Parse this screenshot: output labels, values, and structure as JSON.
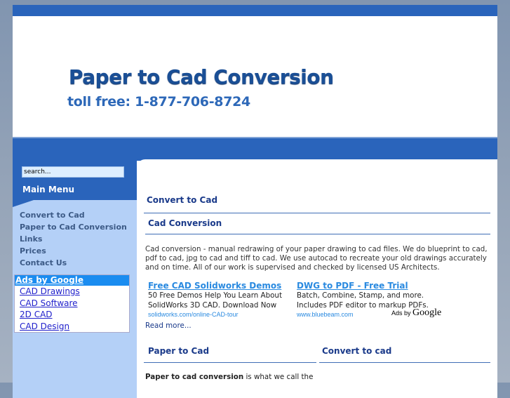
{
  "header": {
    "title": "Paper to Cad Conversion",
    "phone": "toll free: 1-877-706-8724"
  },
  "sidebar": {
    "search_placeholder": "search...",
    "main_menu_label": "Main Menu",
    "menu": [
      "Convert to Cad",
      "Paper to Cad Conversion",
      "Links",
      "Prices",
      "Contact Us"
    ],
    "ads": {
      "heading": "Ads by Google",
      "links": [
        "CAD Drawings",
        "CAD Software",
        "2D CAD",
        "CAD Design"
      ]
    }
  },
  "content": {
    "heading1": "Convert to Cad",
    "heading2": "Cad Conversion",
    "paragraph": "Cad conversion - manual redrawing of your paper drawing to cad files. We do blueprint to cad, pdf to cad, jpg to cad and tiff to cad. We use autocad to recreate your old drawings accurately and on time. All of our work is supervised and checked by licensed US Architects.",
    "ads": [
      {
        "title": "Free CAD Solidworks Demos",
        "line1": "50 Free Demos Help You Learn About",
        "line2": "SolidWorks 3D CAD. Download Now",
        "url": "solidworks.com/online-CAD-tour"
      },
      {
        "title": "DWG to PDF - Free Trial",
        "line1": "Batch, Combine, Stamp, and more.",
        "line2": "Includes PDF editor to markup PDFs.",
        "url": "www.bluebeam.com"
      }
    ],
    "ads_by": "Ads by",
    "ads_google": "Google",
    "read_more": "Read more...",
    "col1_heading": "Paper to Cad",
    "col2_heading": "Convert to cad",
    "p2_bold": "Paper to cad conversion",
    "p2_rest": " is what we call the"
  }
}
